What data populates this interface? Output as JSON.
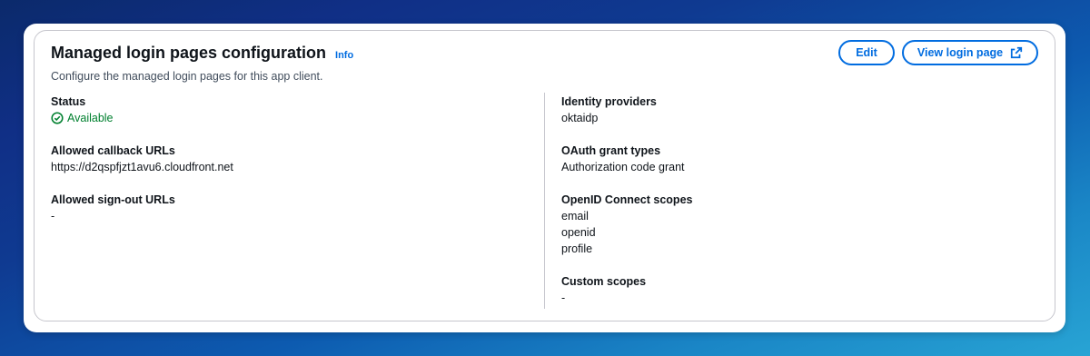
{
  "header": {
    "title": "Managed login pages configuration",
    "info_label": "Info",
    "description": "Configure the managed login pages for this app client."
  },
  "actions": {
    "edit_label": "Edit",
    "view_login_label": "View login page"
  },
  "left_column": {
    "status": {
      "label": "Status",
      "value": "Available",
      "color": "#00802f"
    },
    "callback_urls": {
      "label": "Allowed callback URLs",
      "value": "https://d2qspfjzt1avu6.cloudfront.net"
    },
    "signout_urls": {
      "label": "Allowed sign-out URLs",
      "value": "-"
    }
  },
  "right_column": {
    "identity_providers": {
      "label": "Identity providers",
      "value": "oktaidp"
    },
    "oauth_grant_types": {
      "label": "OAuth grant types",
      "value": "Authorization code grant"
    },
    "oidc_scopes": {
      "label": "OpenID Connect scopes",
      "values": [
        "email",
        "openid",
        "profile"
      ]
    },
    "custom_scopes": {
      "label": "Custom scopes",
      "value": "-"
    }
  },
  "colors": {
    "accent": "#006ce0",
    "success": "#00802f",
    "text": "#0f141a",
    "muted_text": "#414d5c",
    "border": "#c6c6cd"
  },
  "icons": {
    "status": "check-circle-icon",
    "external": "external-link-icon"
  }
}
